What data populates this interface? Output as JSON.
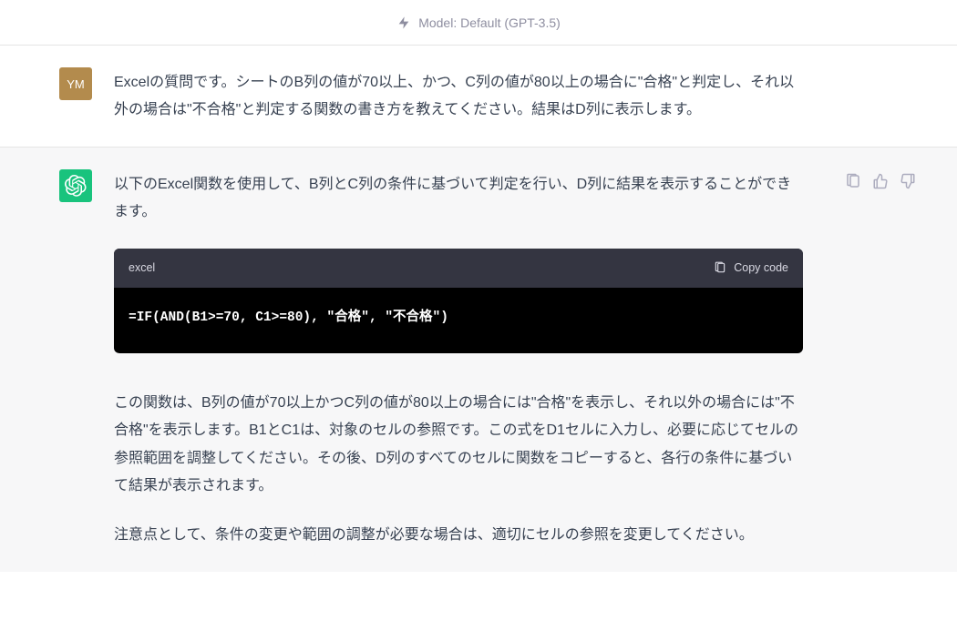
{
  "header": {
    "model_label": "Model: Default (GPT-3.5)"
  },
  "user": {
    "avatar_initials": "YM",
    "message": "Excelの質問です。シートのB列の値が70以上、かつ、C列の値が80以上の場合に\"合格\"と判定し、それ以外の場合は\"不合格\"と判定する関数の書き方を教えてください。結果はD列に表示します。"
  },
  "assistant": {
    "intro": "以下のExcel関数を使用して、B列とC列の条件に基づいて判定を行い、D列に結果を表示することができます。",
    "code": {
      "language": "excel",
      "copy_label": "Copy code",
      "content": "=IF(AND(B1>=70, C1>=80), \"合格\", \"不合格\")"
    },
    "explanation": "この関数は、B列の値が70以上かつC列の値が80以上の場合には\"合格\"を表示し、それ以外の場合には\"不合格\"を表示します。B1とC1は、対象のセルの参照です。この式をD1セルに入力し、必要に応じてセルの参照範囲を調整してください。その後、D列のすべてのセルに関数をコピーすると、各行の条件に基づいて結果が表示されます。",
    "note": "注意点として、条件の変更や範囲の調整が必要な場合は、適切にセルの参照を変更してください。"
  }
}
